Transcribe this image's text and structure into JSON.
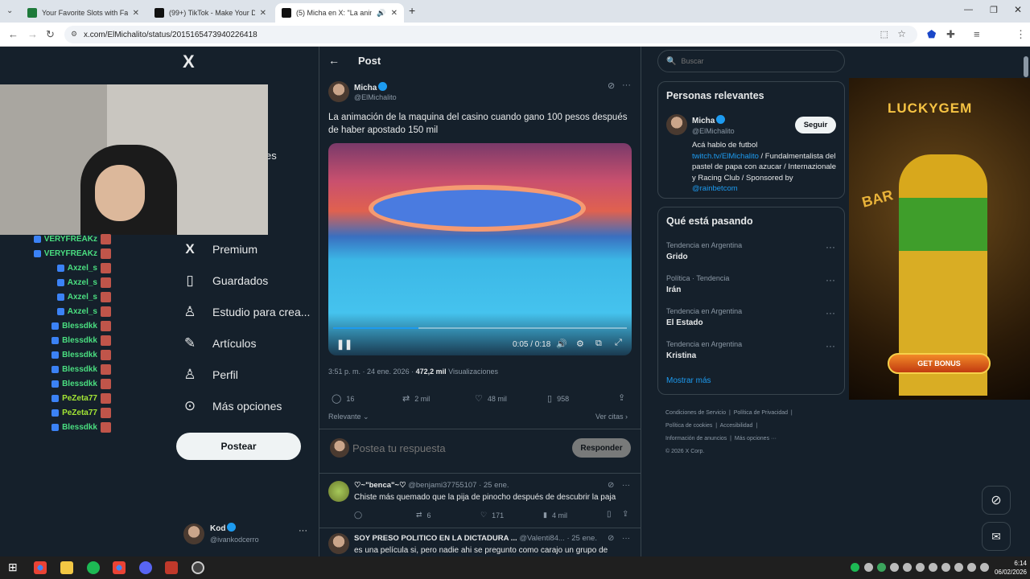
{
  "browser": {
    "tabs": [
      {
        "title": "Your Favorite Slots with Fast Wi",
        "fav_color": "#1e7a3a"
      },
      {
        "title": "(99+) TikTok - Make Your Day",
        "fav_color": "#111111"
      },
      {
        "title": "(5) Micha en X: \"La animació",
        "fav_color": "#111111"
      }
    ],
    "url": "x.com/ElMichalito/status/2015165473940226418",
    "new_tab": "+"
  },
  "logo": "X",
  "chat": [
    {
      "name": "VERYFREAKz",
      "color": "#4ade80"
    },
    {
      "name": "VERYFREAKz",
      "color": "#4ade80"
    },
    {
      "name": "Axzel_s",
      "color": "#4ade80"
    },
    {
      "name": "Axzel_s",
      "color": "#4ade80"
    },
    {
      "name": "Axzel_s",
      "color": "#4ade80"
    },
    {
      "name": "Axzel_s",
      "color": "#4ade80"
    },
    {
      "name": "Blessdkk",
      "color": "#4ade80"
    },
    {
      "name": "Blessdkk",
      "color": "#4ade80"
    },
    {
      "name": "Blessdkk",
      "color": "#4ade80"
    },
    {
      "name": "Blessdkk",
      "color": "#4ade80"
    },
    {
      "name": "Blessdkk",
      "color": "#4ade80"
    },
    {
      "name": "PeZeta77",
      "color": "#a3e635"
    },
    {
      "name": "PeZeta77",
      "color": "#a3e635"
    },
    {
      "name": "Blessdkk",
      "color": "#4ade80"
    }
  ],
  "nav": {
    "partial": "es",
    "premium": "Premium",
    "bookmarks": "Guardados",
    "studio": "Estudio para crea...",
    "articles": "Artículos",
    "profile": "Perfil",
    "more": "Más opciones",
    "post_button": "Postear",
    "account_name": "Kod",
    "account_handle": "@ivankodcerro"
  },
  "post": {
    "header": "Post",
    "author": "Micha",
    "handle": "@ElMichalito",
    "text": "La animación de la maquina del casino cuando gano 100 pesos después de haber apostado 150 mil",
    "video_time": "0:05 / 0:18",
    "video_progress": 0.29,
    "timestamp": "3:51 p. m. · 24 ene. 2026 ·",
    "views": "472,2 mil",
    "views_label": "Visualizaciones",
    "replies": "16",
    "reposts": "2 mil",
    "likes": "48 mil",
    "bookmarks": "958",
    "sort": "Relevante",
    "quotes": "Ver citas"
  },
  "reply_box": {
    "placeholder": "Postea tu respuesta",
    "button": "Responder"
  },
  "replies": [
    {
      "name": "♡~\"benca\"~♡",
      "handle": "@benjami37755107",
      "date": "· 25 ene.",
      "text": "Chiste más quemado que la pija de pinocho después de descubrir la paja",
      "replies": "",
      "reposts": "6",
      "likes": "171",
      "views": "4 mil"
    },
    {
      "name": "SOY PRESO POLITICO EN LA DICTADURA ...",
      "handle": "@Valenti84...",
      "date": "· 25 ene.",
      "text": "es una película si, pero nadie ahi se pregunto como carajo un grupo de"
    }
  ],
  "search": {
    "placeholder": "Buscar"
  },
  "relevant": {
    "title": "Personas relevantes",
    "name": "Micha",
    "handle": "@ElMichalito",
    "follow": "Seguir",
    "bio1": "Acá hablo de futbol",
    "link1": "twitch.tv/ElMichalito",
    "bio2": " / Fundalmentalista del pastel de papa con azucar / Internazionale y Racing Club / Sponsored by ",
    "link2": "@rainbetcom"
  },
  "trends": {
    "title": "Qué está pasando",
    "items": [
      {
        "context": "Tendencia en Argentina",
        "name": "Grido"
      },
      {
        "context": "Política · Tendencia",
        "name": "Irán"
      },
      {
        "context": "Tendencia en Argentina",
        "name": "El Estado"
      },
      {
        "context": "Tendencia en Argentina",
        "name": "Kristina"
      }
    ],
    "more": "Mostrar más"
  },
  "footer": {
    "links": [
      "Condiciones de Servicio",
      "Política de Privacidad",
      "Política de cookies",
      "Accesibilidad",
      "Información de anuncios",
      "Más opciones ···"
    ],
    "copyright": "© 2026 X Corp."
  },
  "ad": {
    "brand": "LUCKYGEM",
    "bar": "BAR",
    "cta": "GET BONUS"
  },
  "clock": {
    "time": "6:14",
    "date": "06/02/2026"
  }
}
